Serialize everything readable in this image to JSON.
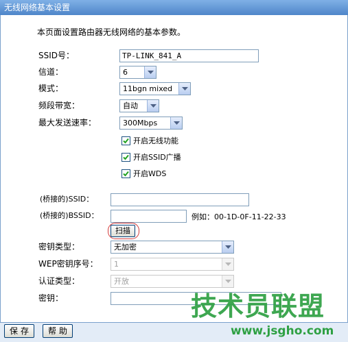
{
  "window": {
    "title": "无线网络基本设置"
  },
  "description": "本页面设置路由器无线网络的基本参数。",
  "form": {
    "ssid": {
      "label": "SSID号：",
      "value": "TP-LINK_841_A"
    },
    "channel": {
      "label": "信道：",
      "value": "6"
    },
    "mode": {
      "label": "模式：",
      "value": "11bgn mixed"
    },
    "bandwidth": {
      "label": "频段带宽：",
      "value": "自动"
    },
    "max_rate": {
      "label": "最大发送速率：",
      "value": "300Mbps"
    },
    "checkboxes": [
      {
        "label": "开启无线功能",
        "checked": true
      },
      {
        "label": "开启SSID广播",
        "checked": true
      },
      {
        "label": "开启WDS",
        "checked": true
      }
    ],
    "bridge_ssid": {
      "label": "(桥接的)SSID：",
      "value": ""
    },
    "bridge_bssid": {
      "label": "(桥接的)BSSID：",
      "value": "",
      "example": "例如：00-1D-0F-11-22-33"
    },
    "scan_button": "扫描",
    "key_type": {
      "label": "密钥类型：",
      "value": "无加密"
    },
    "wep_index": {
      "label": "WEP密钥序号：",
      "value": "1"
    },
    "auth_type": {
      "label": "认证类型：",
      "value": "开放"
    },
    "key": {
      "label": "密钥：",
      "value": ""
    }
  },
  "footer": {
    "save": "保存",
    "help": "帮助"
  },
  "watermark": {
    "text": "技术员联盟",
    "url": "www.jsgho.com"
  },
  "colors": {
    "accent": "#4f86c9",
    "watermark": "#2ea043",
    "highlight_ring": "#d23b3b"
  }
}
